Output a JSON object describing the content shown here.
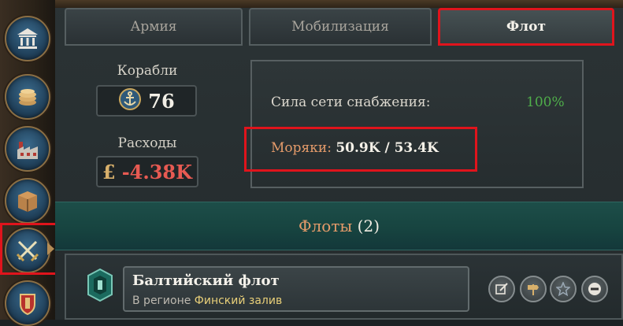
{
  "sidebar": {
    "items": [
      {
        "icon": "government-building-icon"
      },
      {
        "icon": "coins-icon"
      },
      {
        "icon": "factory-icon"
      },
      {
        "icon": "crate-icon"
      },
      {
        "icon": "crossed-swords-icon"
      },
      {
        "icon": "shield-crest-icon"
      }
    ],
    "active_index": 4
  },
  "tabs": [
    {
      "label": "Армия"
    },
    {
      "label": "Мобилизация"
    },
    {
      "label": "Флот"
    }
  ],
  "active_tab": "Флот",
  "stats": {
    "ships": {
      "label": "Корабли",
      "value": "76",
      "icon": "anchor-icon"
    },
    "expenses": {
      "label": "Расходы",
      "value": "-4.38K",
      "currency_symbol": "£"
    }
  },
  "supply": {
    "label": "Сила сети снабжения:",
    "value": "100%"
  },
  "sailors": {
    "label": "Моряки:",
    "value": "50.9K / 53.4K"
  },
  "fleets": {
    "title": "Флоты",
    "count": "(2)",
    "items": [
      {
        "name": "Балтийский флот",
        "region_prefix": "В регионе",
        "region": "Финский залив"
      }
    ]
  },
  "colors": {
    "accent_orange": "#e59b6a",
    "positive_green": "#4fae4a",
    "negative_red": "#e75a52",
    "highlight_red": "#e0141c"
  }
}
